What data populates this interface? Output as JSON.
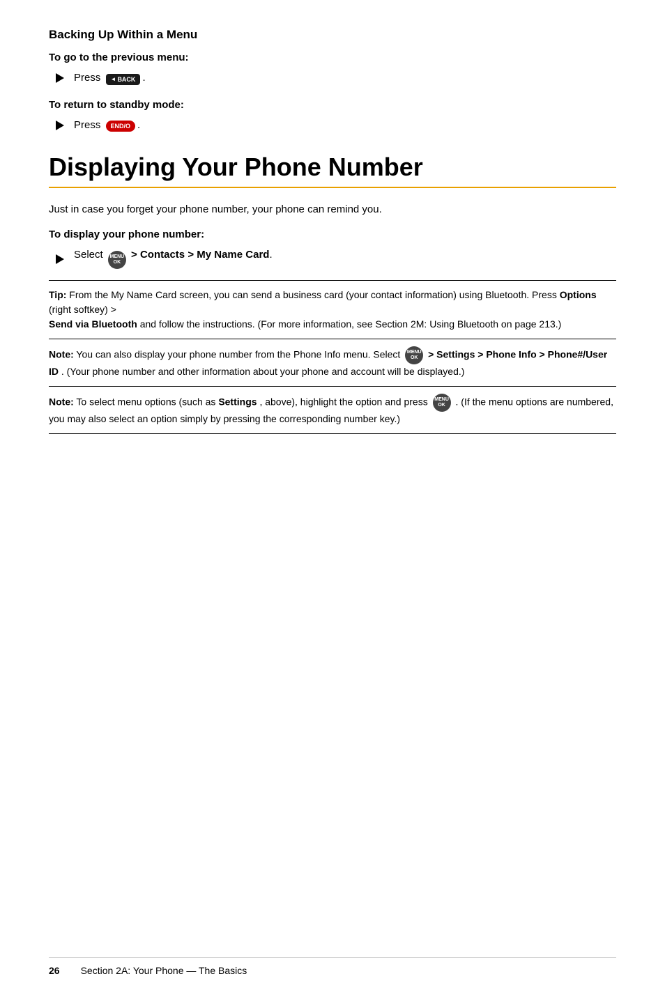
{
  "top_section": {
    "title": "Backing Up Within a Menu",
    "prev_menu_label": "To go to the previous menu:",
    "prev_menu_instruction": "Press",
    "back_key_label": "BACK",
    "standby_label": "To return to standby mode:",
    "standby_instruction": "Press",
    "endo_key_label": "END/O"
  },
  "main_section": {
    "title": "Displaying Your Phone Number",
    "body_text": "Just in case you forget your phone number, your phone can remind you.",
    "display_label": "To display your phone number:",
    "select_text": "Select",
    "contacts_path": "> Contacts > My Name Card",
    "menu_key_label": "MENU OK"
  },
  "tip_box": {
    "label": "Tip:",
    "text": "From the My Name Card screen, you can send a business card (your contact information) using Bluetooth. Press",
    "options_label": "Options",
    "options_suffix": "(right softkey) >",
    "send_label": "Send via Bluetooth",
    "send_suffix": "and follow the instructions. (For more information, see Section 2M: Using Bluetooth on page 213.)"
  },
  "note_box_1": {
    "label": "Note:",
    "text_before": "You can also display your phone number from the Phone Info menu. Select",
    "path": "> Settings > Phone Info > Phone#/User ID",
    "text_after": ". (Your phone number and other information about your phone and account will be displayed.)"
  },
  "note_box_2": {
    "label": "Note:",
    "text_before": "To select menu options (such as",
    "settings_label": "Settings",
    "text_middle": ", above), highlight the option and press",
    "text_after": ". (If the menu options are numbered, you may also select an option simply by pressing the corresponding number key.)"
  },
  "footer": {
    "page_number": "26",
    "section_label": "Section 2A: Your Phone — The Basics"
  }
}
